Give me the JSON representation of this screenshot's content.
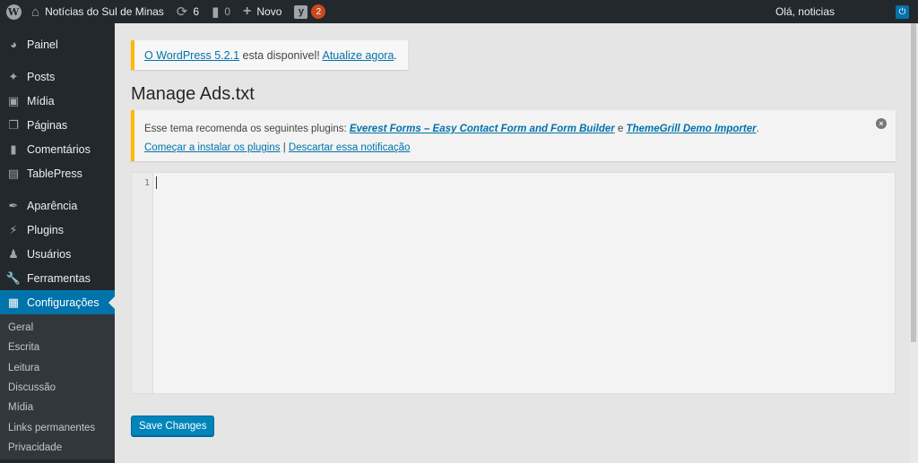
{
  "adminbar": {
    "site_name": "Notícias do Sul de Minas",
    "updates_count": "6",
    "comments_count": "0",
    "new_label": "Novo",
    "yoast_badge": "2",
    "howdy": "Olá, noticias"
  },
  "sidebar": {
    "items": [
      {
        "label": "Painel",
        "icon": "dashboard-icon"
      },
      {
        "label": "Posts",
        "icon": "pin-icon"
      },
      {
        "label": "Mídia",
        "icon": "media-icon"
      },
      {
        "label": "Páginas",
        "icon": "pages-icon"
      },
      {
        "label": "Comentários",
        "icon": "comments-icon"
      },
      {
        "label": "TablePress",
        "icon": "table-icon"
      },
      {
        "label": "Aparência",
        "icon": "brush-icon"
      },
      {
        "label": "Plugins",
        "icon": "plugin-icon"
      },
      {
        "label": "Usuários",
        "icon": "users-icon"
      },
      {
        "label": "Ferramentas",
        "icon": "wrench-icon"
      },
      {
        "label": "Configurações",
        "icon": "settings-icon"
      }
    ],
    "submenu": [
      "Geral",
      "Escrita",
      "Leitura",
      "Discussão",
      "Mídia",
      "Links permanentes",
      "Privacidade"
    ]
  },
  "update_nag": {
    "link1": "O WordPress 5.2.1",
    "text": " esta disponivel! ",
    "link2": "Atualize agora",
    "end": "."
  },
  "page": {
    "title": "Manage Ads.txt"
  },
  "notice": {
    "text": "Esse tema recomenda os seguintes plugins: ",
    "plugin1": "Everest Forms – Easy Contact Form and Form Builder",
    "and": " e ",
    "plugin2": "ThemeGrill Demo Importer",
    "end": ".",
    "install_link": "Começar a instalar os plugins",
    "separator": " | ",
    "dismiss_link": "Descartar essa notificação"
  },
  "editor": {
    "line_number": "1",
    "content": ""
  },
  "save_button": "Save Changes",
  "colors": {
    "accent": "#0073aa",
    "warning": "#ffb900",
    "badge": "#ca4a1f",
    "adminbar": "#23282d"
  }
}
